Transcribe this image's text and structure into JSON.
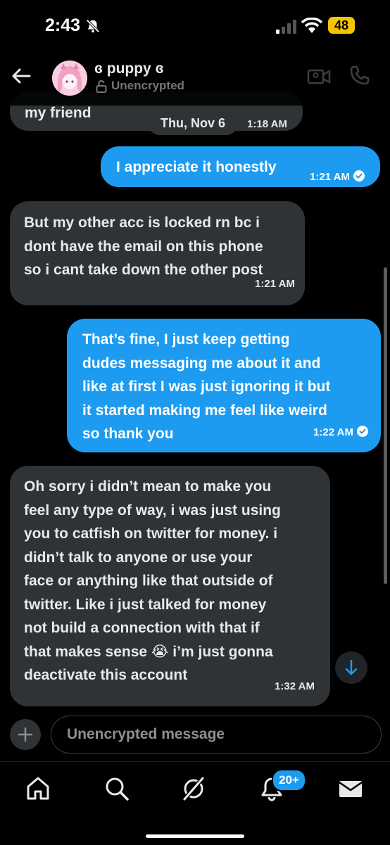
{
  "status_bar": {
    "time": "2:43",
    "battery": "48"
  },
  "header": {
    "name": "ɞ puppy ɞ",
    "encryption": "Unencrypted"
  },
  "conversation": {
    "date_divider": "Thu, Nov 6",
    "messages": [
      {
        "from": "them",
        "lines": [
          "my friend"
        ],
        "time": "1:18 AM"
      },
      {
        "from": "me",
        "lines": [
          "I appreciate it honestly"
        ],
        "time": "1:21 AM",
        "read": true
      },
      {
        "from": "them",
        "lines": [
          "But my other acc is locked rn bc i",
          "dont have the email on this phone",
          "so i cant take down the other post"
        ],
        "time": "1:21 AM"
      },
      {
        "from": "me",
        "lines": [
          "That’s fine, I just keep getting",
          "dudes messaging me about it and",
          "like at first I was just ignoring it but",
          "it started making me feel like weird",
          "so thank you"
        ],
        "time": "1:22 AM",
        "read": true
      },
      {
        "from": "them",
        "lines": [
          "Oh sorry i didn’t mean to make you",
          "feel any type of way, i was just using",
          "you to catfish on twitter for money. i",
          "didn’t talk to anyone or use your",
          "face or anything like that outside of",
          "twitter. Like i just talked for money",
          "not build a connection with that if",
          "that makes sense 😭 i’m just gonna",
          "deactivate this account"
        ],
        "time": "1:32 AM"
      }
    ]
  },
  "composer": {
    "placeholder": "Unencrypted message"
  },
  "tabbar": {
    "items": [
      "home-icon",
      "search-icon",
      "grok-icon",
      "notifications-icon",
      "messages-icon"
    ],
    "notifications_badge": "20+"
  },
  "colors": {
    "accent": "#1d9bf0",
    "incoming_bubble": "#2f3336",
    "background": "#000000"
  }
}
